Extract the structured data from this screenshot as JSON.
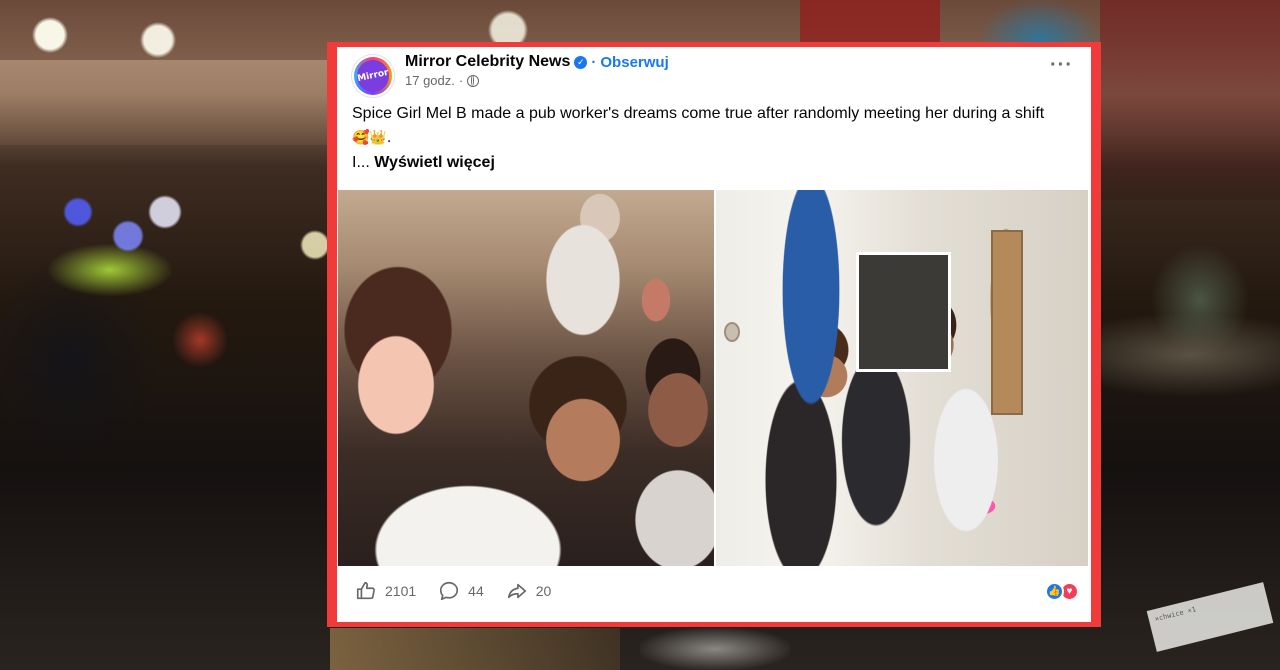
{
  "post": {
    "page_name": "Mirror Celebrity News",
    "follow_label": "Obserwuj",
    "separator": "·",
    "time": "17 godz.",
    "time_separator": "·",
    "avatar_text": "Mirror",
    "text": "Spice Girl Mel B made a pub worker's dreams come true after randomly meeting her during a shift",
    "text_emojis": "🥰👑.",
    "truncated_prefix": "I...",
    "see_more_label": "Wyświetl więcej",
    "photo_count": 2
  },
  "stats": {
    "likes": "2101",
    "comments": "44",
    "shares": "20"
  },
  "icons": {
    "verified": "verified-badge-icon",
    "globe": "globe-icon",
    "more": "more-options-icon",
    "like": "thumbs-up-icon",
    "comment": "comment-bubble-icon",
    "share": "share-arrow-icon",
    "reaction_like": "like-reaction-icon",
    "reaction_love": "love-reaction-icon"
  },
  "colors": {
    "frame": "#f13a3a",
    "accent": "#1877f2",
    "love": "#f33e58",
    "muted_text": "#65676b"
  },
  "receipt_text": "×chwice  ×1"
}
